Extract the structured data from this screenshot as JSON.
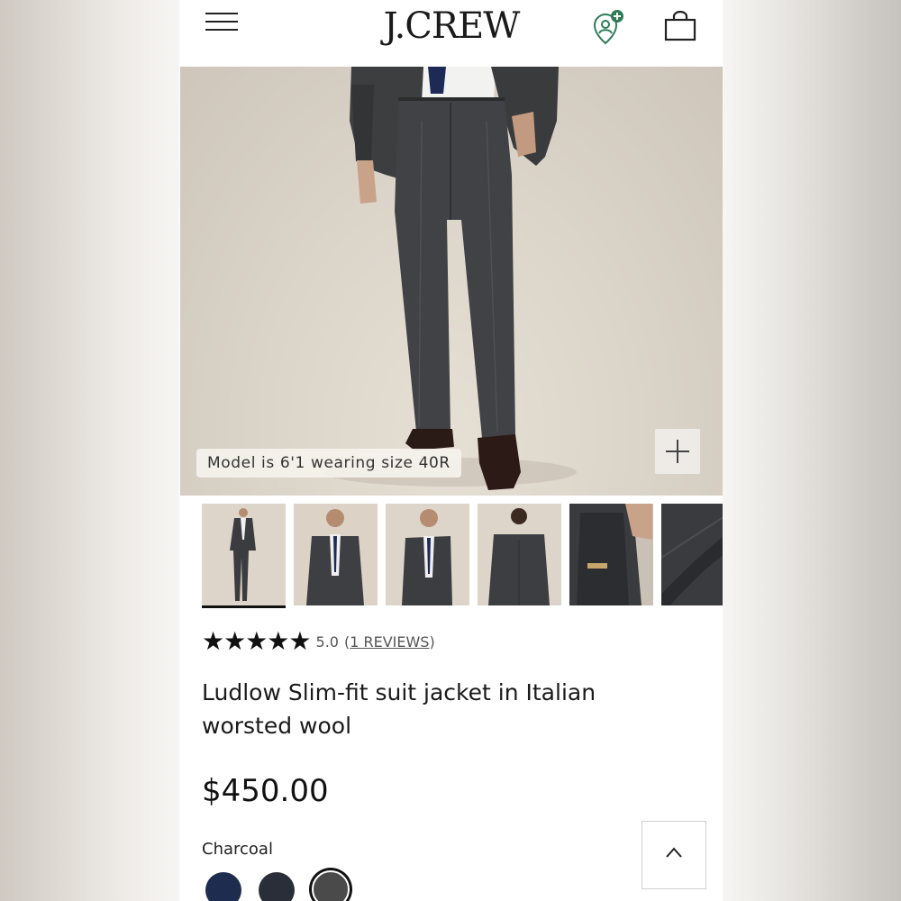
{
  "header": {
    "logo": "J.CREW",
    "menu_icon": "hamburger-menu-icon",
    "account_icon": "account-add-icon",
    "bag_icon": "shopping-bag-icon"
  },
  "hero": {
    "model_caption": "Model is 6'1 wearing size 40R",
    "zoom_icon": "plus-icon"
  },
  "thumbnails": [
    {
      "name": "full-length-front",
      "active": true
    },
    {
      "name": "jacket-front",
      "active": false
    },
    {
      "name": "jacket-three-quarter",
      "active": false
    },
    {
      "name": "jacket-back",
      "active": false
    },
    {
      "name": "jacket-lining",
      "active": false
    },
    {
      "name": "fabric-detail",
      "active": false
    }
  ],
  "product": {
    "stars": "★★★★★",
    "rating": "5.0",
    "reviews_open": "(",
    "reviews_text": "1 REVIEWS",
    "reviews_close": ")",
    "title": "Ludlow Slim-fit suit jacket in Italian worsted wool",
    "price": "$450.00",
    "color_label": "Charcoal",
    "swatches": [
      {
        "name": "navy",
        "color": "#1e2d4f",
        "selected": false
      },
      {
        "name": "dark-navy",
        "color": "#2a2e38",
        "selected": false
      },
      {
        "name": "charcoal",
        "color": "#4a4a4a",
        "selected": true
      }
    ]
  },
  "colors": {
    "accent_green": "#2e7d57",
    "text": "#1a1a1a"
  }
}
